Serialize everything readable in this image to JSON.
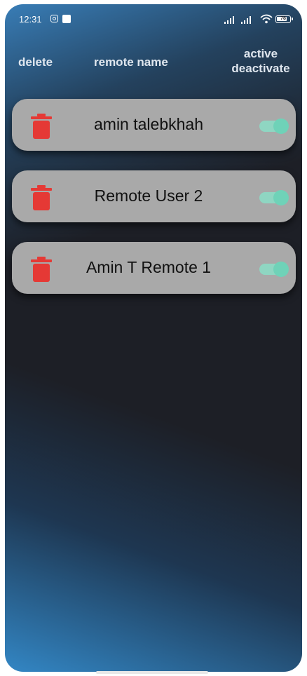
{
  "status_bar": {
    "time": "12:31",
    "battery": "78"
  },
  "header": {
    "delete_label": "delete",
    "name_label": "remote name",
    "active_label_line1": "active",
    "active_label_line2": "deactivate"
  },
  "colors": {
    "card_bg": "#a9a9a9",
    "trash": "#e53935",
    "toggle_track": "#8fd6c2",
    "toggle_thumb": "#6fd2b8",
    "background": "#1d1f26",
    "accent_blue": "#3a82be"
  },
  "remotes": [
    {
      "name": "amin talebkhah",
      "active": true
    },
    {
      "name": "Remote User 2",
      "active": true
    },
    {
      "name": "Amin T Remote 1",
      "active": true
    }
  ]
}
